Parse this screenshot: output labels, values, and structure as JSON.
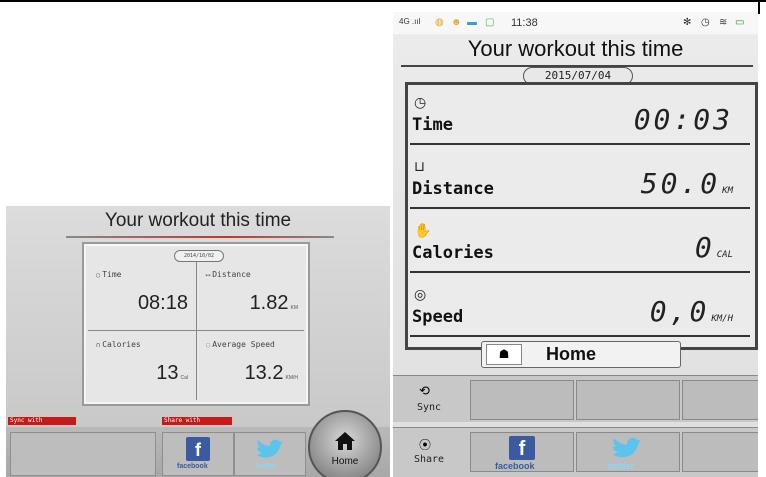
{
  "tablet": {
    "title": "Your workout this time",
    "date": "2014/10/02",
    "time_label": "Time",
    "time_value": "08:18",
    "distance_label": "Distance",
    "distance_value": "1.82",
    "distance_unit": "KM",
    "calories_label": "Calories",
    "calories_value": "13",
    "calories_unit": "Cal",
    "speed_label": "Average Speed",
    "speed_value": "13.2",
    "speed_unit": "KM/H",
    "sync_label": "Sync with",
    "share_label": "Share with",
    "facebook_label": "facebook",
    "twitter_label": "twitter",
    "home_label": "Home"
  },
  "phone": {
    "status": {
      "signal": "4G .ııl",
      "time": "11:38"
    },
    "title": "Your workout this time",
    "date": "2015/07/04",
    "time_label": "Time",
    "time_value": "00:03",
    "distance_label": "Distance",
    "distance_value": "50.0",
    "distance_unit": "KM",
    "calories_label": "Calories",
    "calories_value": "0",
    "calories_unit": "CAL",
    "speed_label": "Speed",
    "speed_value": "0,0",
    "speed_unit": "KM/H",
    "home_label": "Home",
    "sync_label": "Sync",
    "share_label": "Share",
    "facebook_label": "facebook",
    "twitter_label": "twitter"
  },
  "colors": {
    "sync_share_red": "#c81818",
    "facebook_blue": "#3b5b9e",
    "twitter_blue": "#5bc4ec"
  },
  "icons": [
    "clock-icon",
    "distance-icon",
    "calories-icon",
    "speed-icon",
    "home-icon",
    "sync-icon",
    "share-icon",
    "facebook-icon",
    "twitter-icon"
  ]
}
